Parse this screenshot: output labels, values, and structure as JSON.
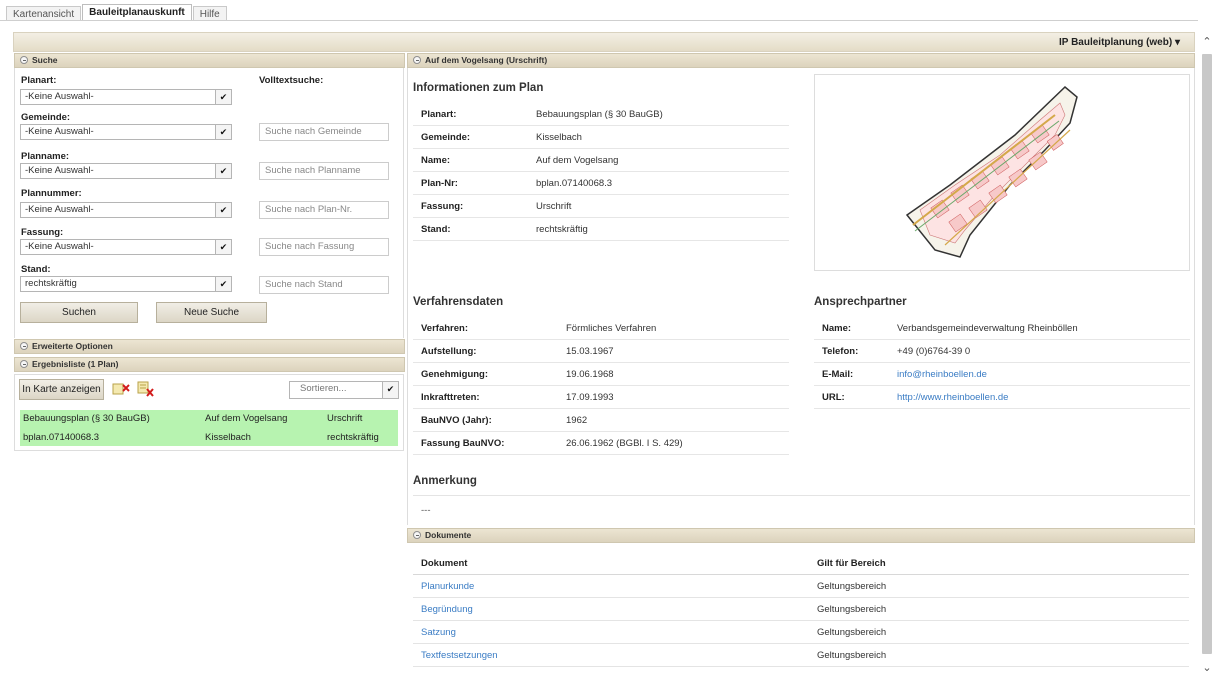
{
  "tabs": [
    "Kartenansicht",
    "Bauleitplanauskunft",
    "Hilfe"
  ],
  "app_title": "IP Bauleitplanung (web)",
  "search": {
    "header": "Suche",
    "fulltext_label": "Volltextsuche:",
    "fields": [
      {
        "label": "Planart:",
        "value": "-Keine Auswahl-",
        "placeholder": ""
      },
      {
        "label": "Gemeinde:",
        "value": "-Keine Auswahl-",
        "placeholder": "Suche nach Gemeinde"
      },
      {
        "label": "Planname:",
        "value": "-Keine Auswahl-",
        "placeholder": "Suche nach Planname"
      },
      {
        "label": "Plannummer:",
        "value": "-Keine Auswahl-",
        "placeholder": "Suche nach Plan-Nr."
      },
      {
        "label": "Fassung:",
        "value": "-Keine Auswahl-",
        "placeholder": "Suche nach Fassung"
      },
      {
        "label": "Stand:",
        "value": "rechtskräftig",
        "placeholder": "Suche nach Stand"
      }
    ],
    "search_button": "Suchen",
    "new_search_button": "Neue Suche"
  },
  "advanced_header": "Erweiterte Optionen",
  "results": {
    "header": "Ergebnisliste (1 Plan)",
    "show_on_map_button": "In Karte anzeigen",
    "sort_placeholder": "Sortieren...",
    "row": {
      "planart": "Bebauungsplan (§ 30 BauGB)",
      "name": "Auf dem Vogelsang",
      "fassung": "Urschrift",
      "nr": "bplan.07140068.3",
      "gemeinde": "Kisselbach",
      "stand": "rechtskräftig"
    }
  },
  "detail": {
    "header": "Auf dem Vogelsang (Urschrift)",
    "info_title": "Informationen zum Plan",
    "info": [
      {
        "key": "Planart:",
        "value": "Bebauungsplan (§ 30 BauGB)"
      },
      {
        "key": "Gemeinde:",
        "value": "Kisselbach"
      },
      {
        "key": "Name:",
        "value": "Auf dem Vogelsang"
      },
      {
        "key": "Plan-Nr:",
        "value": "bplan.07140068.3"
      },
      {
        "key": "Fassung:",
        "value": "Urschrift"
      },
      {
        "key": "Stand:",
        "value": "rechtskräftig"
      }
    ],
    "proc_title": "Verfahrensdaten",
    "proc": [
      {
        "key": "Verfahren:",
        "value": "Förmliches Verfahren"
      },
      {
        "key": "Aufstellung:",
        "value": "15.03.1967"
      },
      {
        "key": "Genehmigung:",
        "value": "19.06.1968"
      },
      {
        "key": "Inkrafttreten:",
        "value": "17.09.1993"
      },
      {
        "key": "BauNVO (Jahr):",
        "value": "1962"
      },
      {
        "key": "Fassung BauNVO:",
        "value": "26.06.1962 (BGBl. I S. 429)"
      }
    ],
    "contact_title": "Ansprechpartner",
    "contact": [
      {
        "key": "Name:",
        "value": "Verbandsgemeindeverwaltung Rheinböllen"
      },
      {
        "key": "Telefon:",
        "value": "+49 (0)6764-39 0"
      },
      {
        "key": "E-Mail:",
        "value": "info@rheinboellen.de"
      },
      {
        "key": "URL:",
        "value": "http://www.rheinboellen.de"
      }
    ],
    "remark_title": "Anmerkung",
    "remark": "---"
  },
  "documents": {
    "header": "Dokumente",
    "col_doc": "Dokument",
    "col_area": "Gilt für Bereich",
    "rows": [
      {
        "doc": "Planurkunde",
        "area": "Geltungsbereich"
      },
      {
        "doc": "Begründung",
        "area": "Geltungsbereich"
      },
      {
        "doc": "Satzung",
        "area": "Geltungsbereich"
      },
      {
        "doc": "Textfestsetzungen",
        "area": "Geltungsbereich"
      }
    ]
  }
}
